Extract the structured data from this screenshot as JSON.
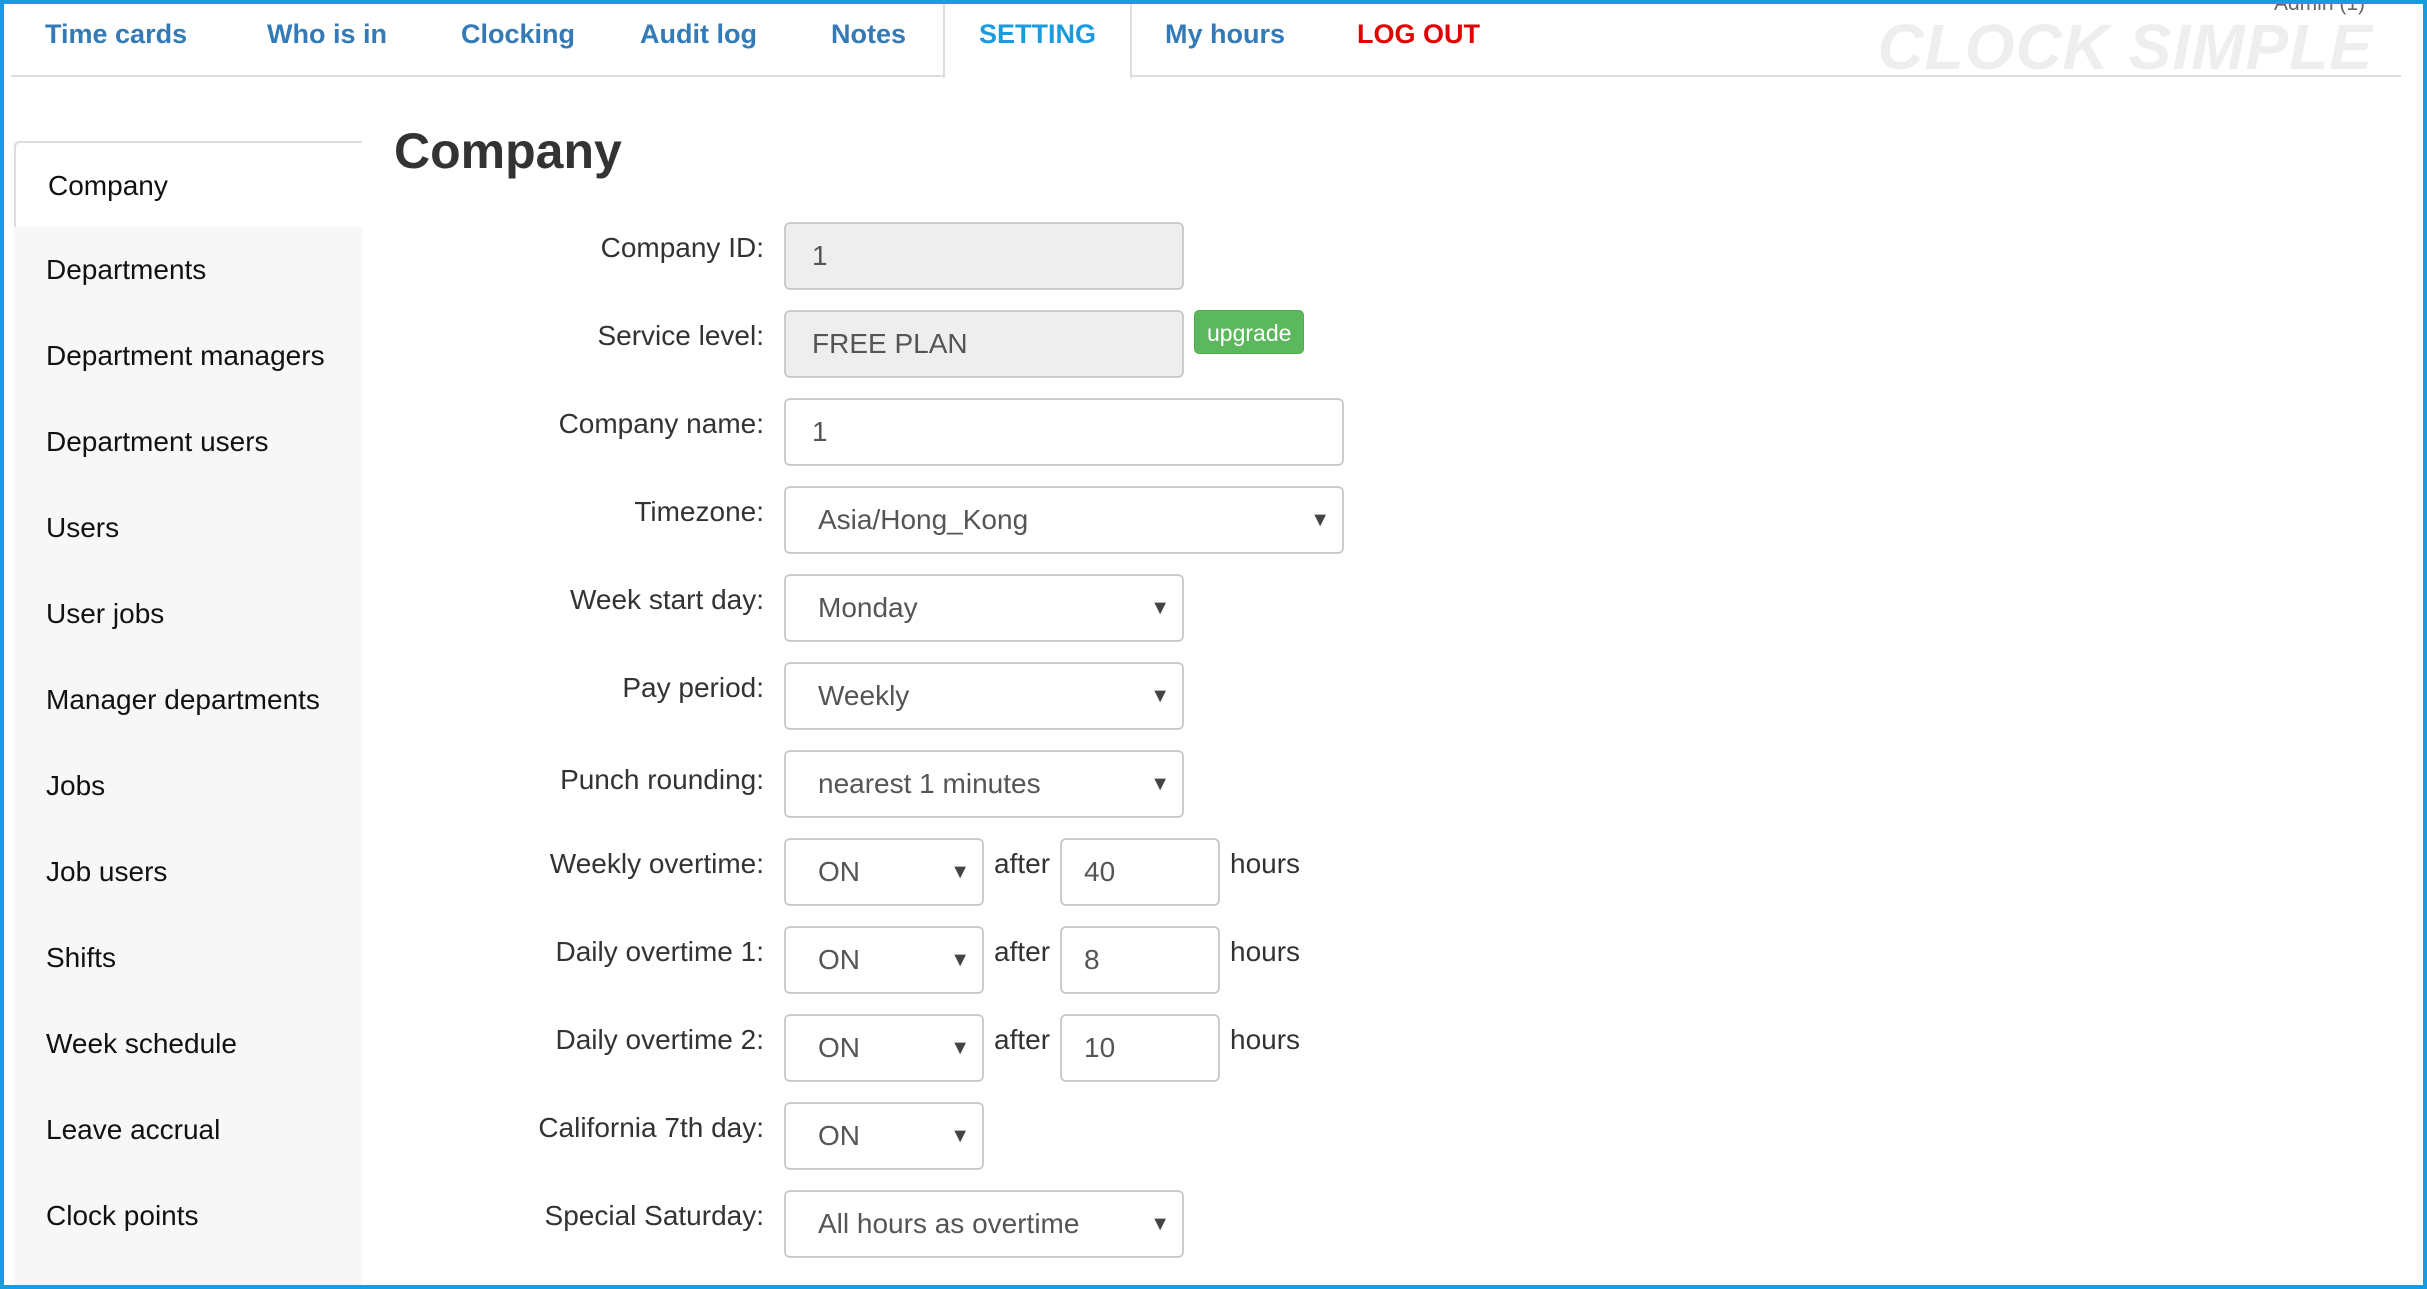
{
  "nav": {
    "tabs": [
      {
        "label": "Time cards"
      },
      {
        "label": "Who is in"
      },
      {
        "label": "Clocking"
      },
      {
        "label": "Audit log"
      },
      {
        "label": "Notes"
      },
      {
        "label": "SETTING"
      },
      {
        "label": "My hours"
      },
      {
        "label": "LOG OUT"
      }
    ],
    "active_tab": "SETTING",
    "brand": "CLOCK SIMPLE",
    "user": "Admin (1)",
    "colors": {
      "link": "#337ab7",
      "active": "#1a9be0",
      "logout": "#e40000",
      "frame": "#1a9be0"
    }
  },
  "sidebar": {
    "items": [
      {
        "label": "Company"
      },
      {
        "label": "Departments"
      },
      {
        "label": "Department managers"
      },
      {
        "label": "Department users"
      },
      {
        "label": "Users"
      },
      {
        "label": "User jobs"
      },
      {
        "label": "Manager departments"
      },
      {
        "label": "Jobs"
      },
      {
        "label": "Job users"
      },
      {
        "label": "Shifts"
      },
      {
        "label": "Week schedule"
      },
      {
        "label": "Leave accrual"
      },
      {
        "label": "Clock points"
      }
    ],
    "active_item": "Company"
  },
  "form": {
    "title": "Company",
    "company_id": {
      "label": "Company ID:",
      "value": "1"
    },
    "service_level": {
      "label": "Service level:",
      "value": "FREE PLAN",
      "button": "upgrade",
      "button_color": "#5cb85c"
    },
    "company_name": {
      "label": "Company name:",
      "value": "1"
    },
    "timezone": {
      "label": "Timezone:",
      "value": "Asia/Hong_Kong"
    },
    "week_start_day": {
      "label": "Week start day:",
      "value": "Monday"
    },
    "pay_period": {
      "label": "Pay period:",
      "value": "Weekly"
    },
    "punch_rounding": {
      "label": "Punch rounding:",
      "value": "nearest 1 minutes"
    },
    "weekly_overtime": {
      "label": "Weekly overtime:",
      "value": "ON",
      "after": "after",
      "hours_value": "40",
      "unit": "hours"
    },
    "daily_overtime_1": {
      "label": "Daily overtime 1:",
      "value": "ON",
      "after": "after",
      "hours_value": "8",
      "unit": "hours"
    },
    "daily_overtime_2": {
      "label": "Daily overtime 2:",
      "value": "ON",
      "after": "after",
      "hours_value": "10",
      "unit": "hours"
    },
    "california_7th_day": {
      "label": "California 7th day:",
      "value": "ON"
    },
    "special_saturday": {
      "label": "Special Saturday:",
      "value": "All hours as overtime"
    }
  }
}
